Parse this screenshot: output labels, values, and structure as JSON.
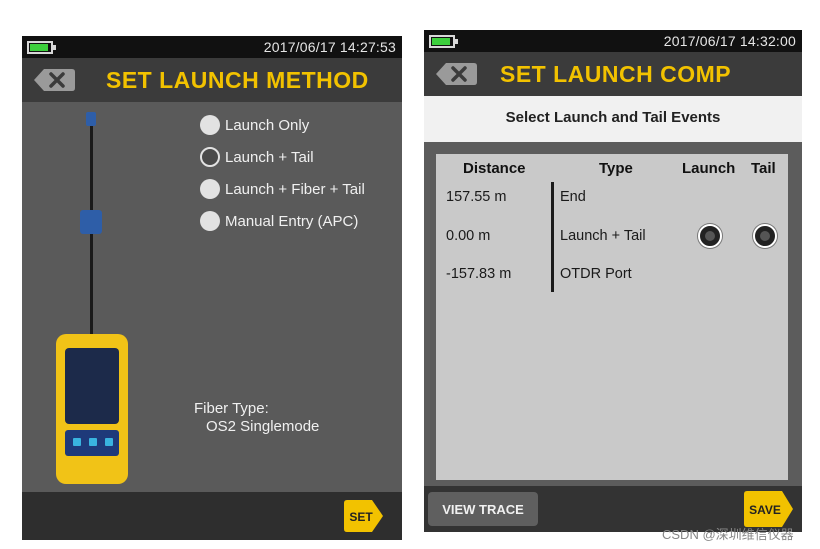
{
  "left": {
    "clock": "2017/06/17 14:27:53",
    "title": "SET LAUNCH METHOD",
    "options": [
      {
        "label": "Launch Only",
        "selected": false
      },
      {
        "label": "Launch + Tail",
        "selected": true
      },
      {
        "label": "Launch + Fiber + Tail",
        "selected": false
      },
      {
        "label": "Manual Entry (APC)",
        "selected": false
      }
    ],
    "fiber_type_label": "Fiber Type:",
    "fiber_type_value": "OS2 Singlemode",
    "set_label": "SET"
  },
  "right": {
    "clock": "2017/06/17 14:32:00",
    "title": "SET LAUNCH COMP",
    "subheader": "Select Launch and Tail Events",
    "columns": [
      "Distance",
      "Type",
      "Launch",
      "Tail"
    ],
    "rows": [
      {
        "distance": "157.55 m",
        "type": "End"
      },
      {
        "distance": "0.00 m",
        "type": "Launch + Tail"
      },
      {
        "distance": "-157.83 m",
        "type": "OTDR Port"
      }
    ],
    "view_trace_label": "VIEW TRACE",
    "save_label": "SAVE"
  },
  "colors": {
    "accent": "#f2c200",
    "battery": "#3ccf3c",
    "connector": "#2e5ea8"
  },
  "watermark": "CSDN @深圳维信仪器"
}
